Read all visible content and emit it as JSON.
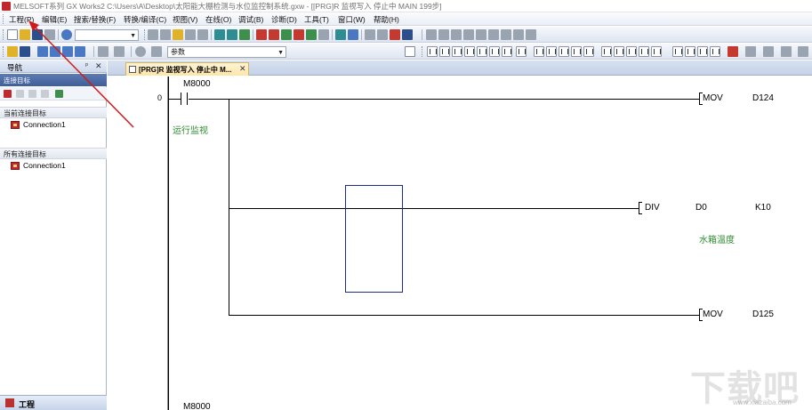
{
  "window": {
    "title": "MELSOFT系列 GX Works2 C:\\Users\\A\\Desktop\\太阳能大棚检测与水位监控制系统.gxw - [[PRG]R 监视写入 停止中 MAIN 199步]"
  },
  "menubar": {
    "items": [
      "工程(P)",
      "编辑(E)",
      "搜索/替换(F)",
      "转换/编译(C)",
      "视图(V)",
      "在线(O)",
      "调试(B)",
      "诊断(D)",
      "工具(T)",
      "窗口(W)",
      "帮助(H)"
    ]
  },
  "toolbar": {
    "search_combo_value": "",
    "param_combo_value": "参数"
  },
  "navigation": {
    "title": "导航",
    "pin_icon": "pin-icon",
    "close_icon": "close-icon",
    "subheader": "连接目标",
    "current_group": "当前连接目标",
    "current_items": [
      "Connection1"
    ],
    "all_group": "所有连接目标",
    "all_items": [
      "Connection1"
    ],
    "bottom_label": "工程"
  },
  "tabs": {
    "active_label": "[PRG]R 监视写入 停止中 M..."
  },
  "ladder": {
    "rung0": {
      "step": "0",
      "contact_device": "M8000",
      "contact_comment": "运行监视",
      "instr1": {
        "op": "MOV",
        "arg": "D124"
      },
      "instr2": {
        "op": "DIV",
        "arg1": "D0",
        "arg2": "K10",
        "comment": "水箱温度"
      },
      "instr3": {
        "op": "MOV",
        "arg": "D125"
      }
    },
    "rung1_contact_device": "M8000"
  },
  "watermark": {
    "text": "下载吧",
    "url": "www.xiazaiba.com"
  },
  "colors": {
    "comment_green": "#2e8b2e",
    "selection_border": "#1c2b8c",
    "annotation_red": "#d11a1a",
    "nav_header_blue": "#4f6ea8"
  }
}
